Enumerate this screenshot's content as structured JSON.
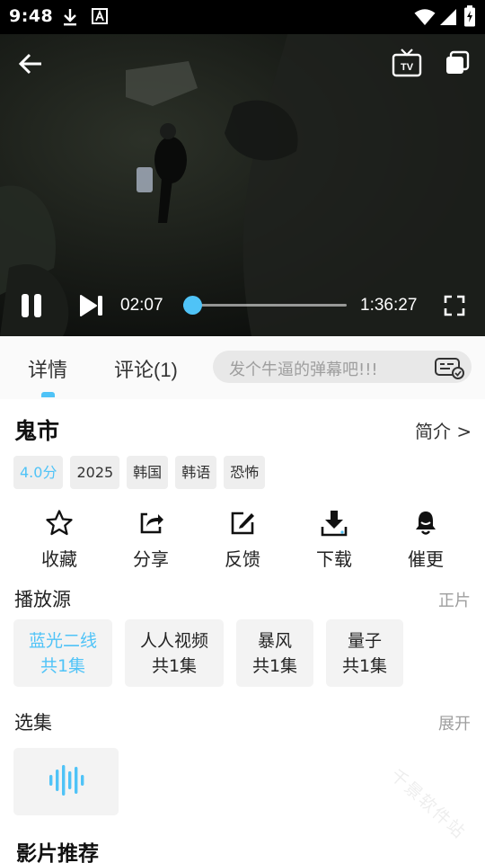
{
  "status_bar": {
    "time": "9:48",
    "icons": [
      "download-icon",
      "a-icon",
      "wifi-icon",
      "signal-icon",
      "battery-charging-icon"
    ]
  },
  "player": {
    "current_time": "02:07",
    "total_time": "1:36:27",
    "progress_fraction": 0.022,
    "icons": [
      "back-arrow-icon",
      "tv-cast-icon",
      "pip-icon",
      "pause-icon",
      "next-icon",
      "fullscreen-icon"
    ],
    "tv_label": "TV"
  },
  "tabs": [
    {
      "label": "详情",
      "active": true
    },
    {
      "label": "评论(1)",
      "active": false
    }
  ],
  "danmu": {
    "placeholder": "发个牛逼的弹幕吧!!!",
    "icon": "danmu-settings-icon"
  },
  "movie": {
    "title": "鬼市",
    "intro_link": "简介 >",
    "tags": [
      "4.0分",
      "2025",
      "韩国",
      "韩语",
      "恐怖"
    ]
  },
  "actions": [
    {
      "label": "收藏",
      "icon": "star-icon"
    },
    {
      "label": "分享",
      "icon": "share-icon"
    },
    {
      "label": "反馈",
      "icon": "edit-icon"
    },
    {
      "label": "下载",
      "icon": "download-icon"
    },
    {
      "label": "催更",
      "icon": "bell-icon"
    }
  ],
  "sources_section": {
    "title": "播放源",
    "right": "正片",
    "items": [
      {
        "name": "蓝光二线",
        "count": "共1集",
        "active": true
      },
      {
        "name": "人人视频",
        "count": "共1集",
        "active": false
      },
      {
        "name": "暴风",
        "count": "共1集",
        "active": false
      },
      {
        "name": "量子",
        "count": "共1集",
        "active": false
      }
    ]
  },
  "episodes_section": {
    "title": "选集",
    "right": "展开",
    "items": [
      {
        "icon": "sound-wave-icon",
        "playing": true
      }
    ]
  },
  "recommend_title": "影片推荐",
  "watermark": "千景软件站",
  "colors": {
    "accent": "#4fc3f7",
    "status_bar": "#000000",
    "tag_bg": "#eeeeee"
  }
}
